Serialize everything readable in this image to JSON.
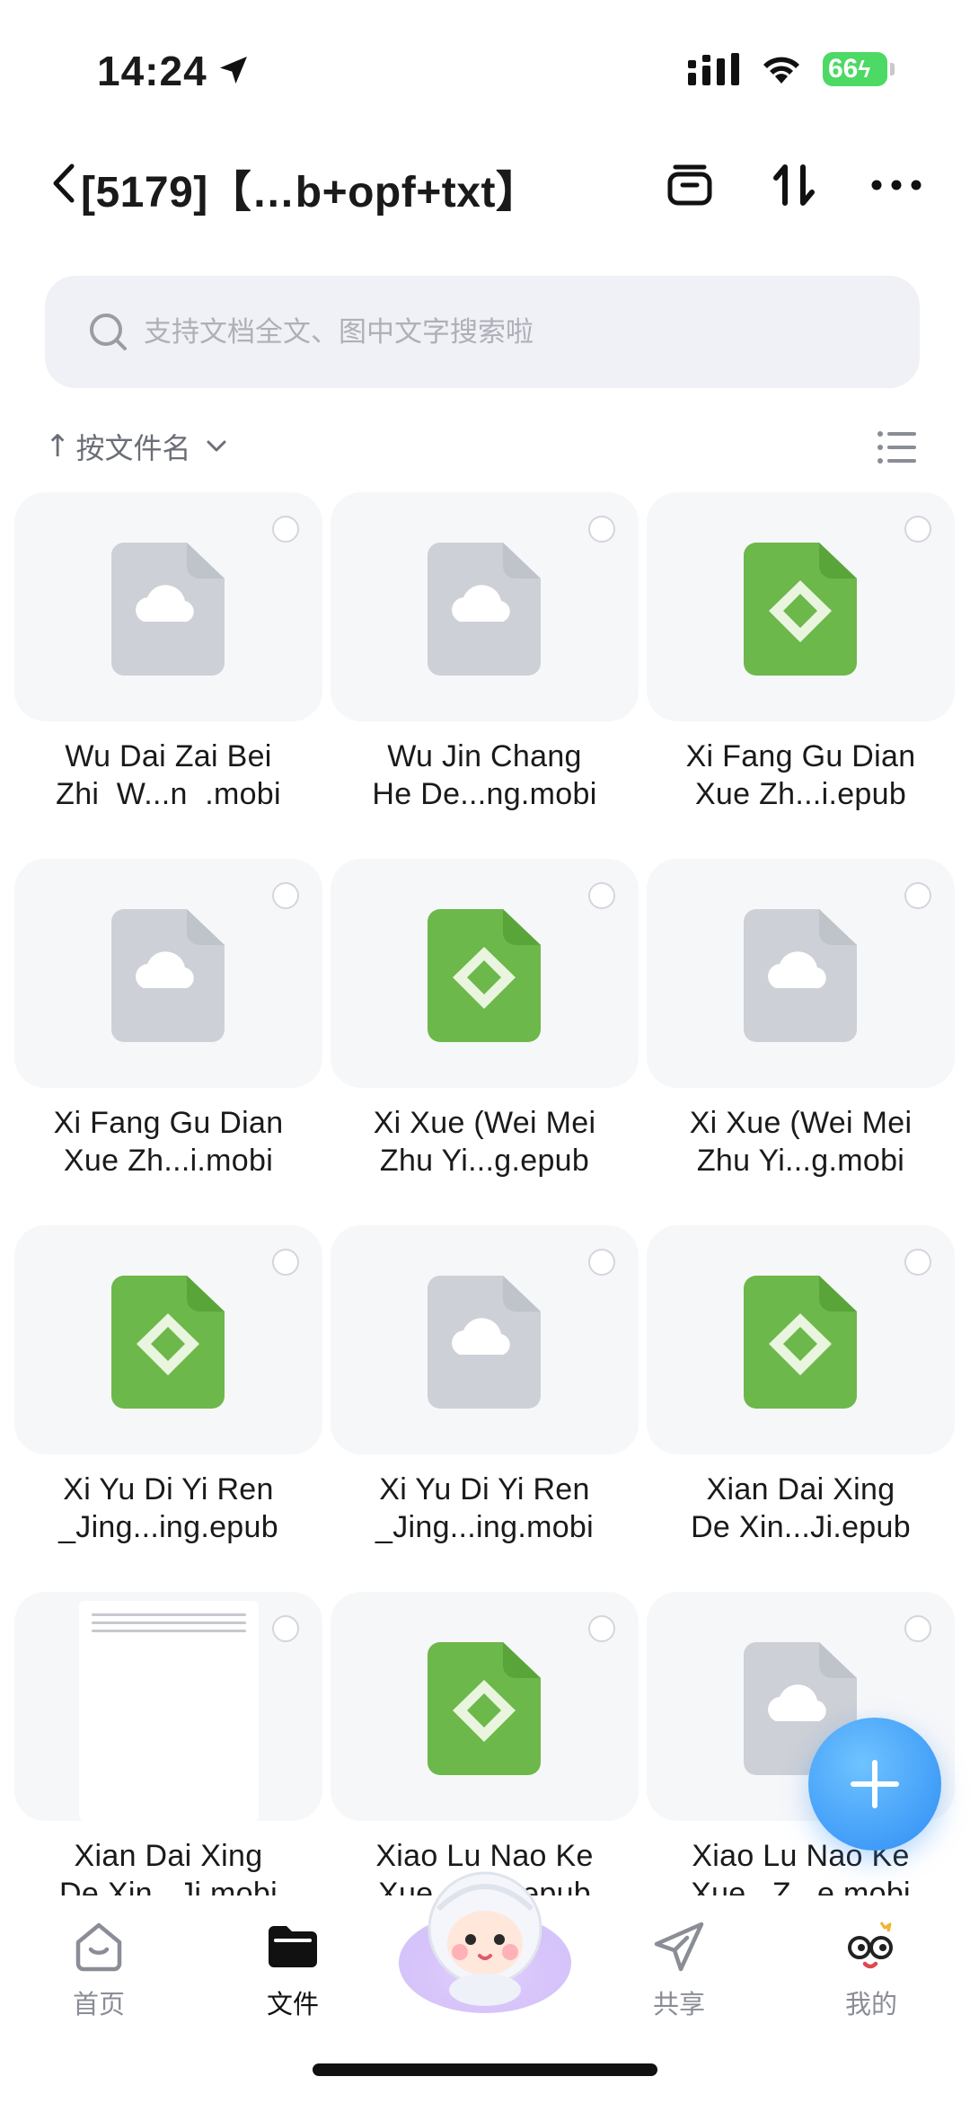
{
  "status_bar": {
    "time": "14:24",
    "battery": "66"
  },
  "header": {
    "title": "[5179]【…b+opf+txt】"
  },
  "search": {
    "placeholder": "支持文档全文、图中文字搜索啦"
  },
  "sort": {
    "label": "按文件名",
    "arrow": "↑"
  },
  "files": [
    {
      "line1": "Wu Dai Zai Bei",
      "line2": "Zhi  W...n  .mobi",
      "icon": "cloud-file-icon"
    },
    {
      "line1": "Wu Jin Chang",
      "line2": "He De...ng.mobi",
      "icon": "cloud-file-icon"
    },
    {
      "line1": "Xi Fang Gu Dian",
      "line2": "Xue Zh...i.epub",
      "icon": "epub-file-icon"
    },
    {
      "line1": "Xi Fang Gu Dian",
      "line2": "Xue Zh...i.mobi",
      "icon": "cloud-file-icon"
    },
    {
      "line1": "Xi Xue (Wei Mei",
      "line2": "Zhu Yi...g.epub",
      "icon": "epub-file-icon"
    },
    {
      "line1": "Xi Xue (Wei Mei",
      "line2": "Zhu Yi...g.mobi",
      "icon": "cloud-file-icon"
    },
    {
      "line1": "Xi Yu Di Yi Ren",
      "line2": "_Jing...ing.epub",
      "icon": "epub-file-icon"
    },
    {
      "line1": "Xi Yu Di Yi Ren",
      "line2": "_Jing...ing.mobi",
      "icon": "cloud-file-icon"
    },
    {
      "line1": "Xian Dai Xing",
      "line2": "De Xin...Ji.epub",
      "icon": "epub-file-icon"
    },
    {
      "line1": "Xian Dai Xing",
      "line2": "De Xin...Ji.mobi",
      "icon": "txt-preview"
    },
    {
      "line1": "Xiao Lu Nao Ke",
      "line2": "Xue...Zh...epub",
      "icon": "epub-file-icon"
    },
    {
      "line1": "Xiao Lu Nao Ke",
      "line2": "Xue...Z...e.mobi",
      "icon": "cloud-file-icon"
    }
  ],
  "tabs": [
    {
      "label": "首页",
      "icon": "home-icon"
    },
    {
      "label": "文件",
      "icon": "folder-icon"
    },
    {
      "label": "共享",
      "icon": "share-icon"
    },
    {
      "label": "我的",
      "icon": "profile-icon"
    }
  ],
  "colors": {
    "accent": "#2e8df5",
    "epub_green": "#6cb84b",
    "cloud_gray": "#cdd0d6"
  }
}
